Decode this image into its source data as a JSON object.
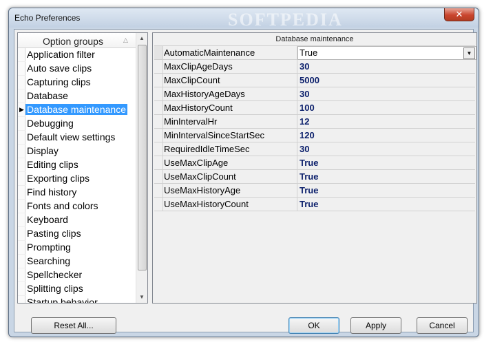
{
  "window": {
    "title": "Echo Preferences",
    "watermark": "SOFTPEDIA",
    "close_glyph": "✕"
  },
  "option_groups": {
    "header": "Option groups",
    "sort_glyph": "△",
    "selected_arrow": "▶",
    "items": [
      {
        "label": "Application filter"
      },
      {
        "label": "Auto save clips"
      },
      {
        "label": "Capturing clips"
      },
      {
        "label": "Database"
      },
      {
        "label": "Database maintenance"
      },
      {
        "label": "Debugging"
      },
      {
        "label": "Default view settings"
      },
      {
        "label": "Display"
      },
      {
        "label": "Editing clips"
      },
      {
        "label": "Exporting clips"
      },
      {
        "label": "Find history"
      },
      {
        "label": "Fonts and colors"
      },
      {
        "label": "Keyboard"
      },
      {
        "label": "Pasting clips"
      },
      {
        "label": "Prompting"
      },
      {
        "label": "Searching"
      },
      {
        "label": "Spellchecker"
      },
      {
        "label": "Splitting clips"
      },
      {
        "label": "Startup behavior"
      }
    ],
    "selected_index": 4,
    "scroll_up": "▲",
    "scroll_down": "▼"
  },
  "properties": {
    "section_title": "Database maintenance",
    "dropdown_glyph": "▼",
    "rows": [
      {
        "name": "AutomaticMaintenance",
        "value": "True"
      },
      {
        "name": "MaxClipAgeDays",
        "value": "30"
      },
      {
        "name": "MaxClipCount",
        "value": "5000"
      },
      {
        "name": "MaxHistoryAgeDays",
        "value": "30"
      },
      {
        "name": "MaxHistoryCount",
        "value": "100"
      },
      {
        "name": "MinIntervalHr",
        "value": "12"
      },
      {
        "name": "MinIntervalSinceStartSec",
        "value": "120"
      },
      {
        "name": "RequiredIdleTimeSec",
        "value": "30"
      },
      {
        "name": "UseMaxClipAge",
        "value": "True"
      },
      {
        "name": "UseMaxClipCount",
        "value": "True"
      },
      {
        "name": "UseMaxHistoryAge",
        "value": "True"
      },
      {
        "name": "UseMaxHistoryCount",
        "value": "True"
      }
    ]
  },
  "buttons": {
    "reset": "Reset All...",
    "ok": "OK",
    "apply": "Apply",
    "cancel": "Cancel"
  }
}
